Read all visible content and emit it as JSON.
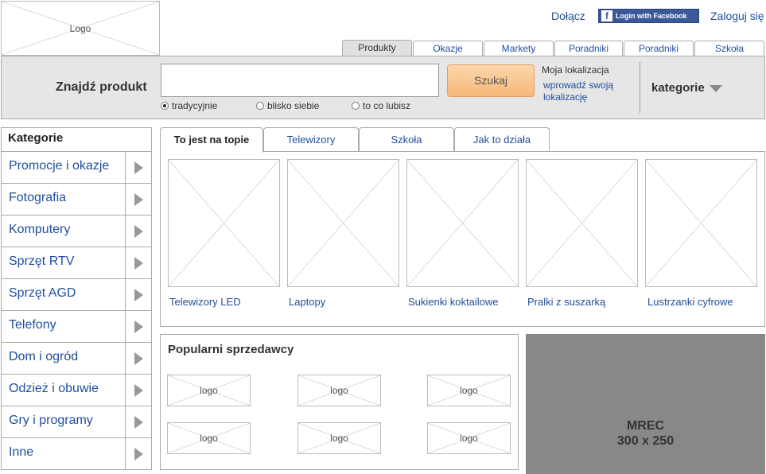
{
  "header": {
    "logo_label": "Logo",
    "join_label": "Dołącz",
    "facebook_label": "Login with Facebook",
    "login_label": "Zaloguj się",
    "top_tabs": [
      {
        "label": "Produkty",
        "active": true
      },
      {
        "label": "Okazje"
      },
      {
        "label": "Markety"
      },
      {
        "label": "Poradniki"
      },
      {
        "label": "Poradniki"
      },
      {
        "label": "Szkoła"
      }
    ]
  },
  "search": {
    "title": "Znajdź produkt",
    "input_value": "",
    "button_label": "Szukaj",
    "modes": [
      {
        "label": "tradycyjnie",
        "selected": true
      },
      {
        "label": "blisko siebie"
      },
      {
        "label": "to co lubisz"
      }
    ],
    "location_label": "Moja lokalizacja",
    "location_link": "wprowadź swoją lokalizację",
    "categories_label": "kategorie"
  },
  "sidebar": {
    "title": "Kategorie",
    "items": [
      {
        "label": "Promocje i okazje"
      },
      {
        "label": "Fotografia"
      },
      {
        "label": "Komputery"
      },
      {
        "label": "Sprzęt RTV"
      },
      {
        "label": "Sprzęt AGD"
      },
      {
        "label": "Telefony"
      },
      {
        "label": "Dom i ogród"
      },
      {
        "label": "Odzież i obuwie"
      },
      {
        "label": "Gry i programy"
      },
      {
        "label": "Inne"
      }
    ]
  },
  "main": {
    "tabs": [
      {
        "label": "To jest na topie",
        "active": true
      },
      {
        "label": "Telewizory"
      },
      {
        "label": "Szkoła"
      },
      {
        "label": "Jak to działa"
      }
    ],
    "products": [
      {
        "caption": "Telewizory LED"
      },
      {
        "caption": "Laptopy"
      },
      {
        "caption": "Sukienki koktailowe"
      },
      {
        "caption": "Pralki z suszarką"
      },
      {
        "caption": "Lustrzanki cyfrowe"
      }
    ]
  },
  "sellers": {
    "title": "Popularni sprzedawcy",
    "logos": [
      "logo",
      "logo",
      "logo",
      "logo",
      "logo",
      "logo"
    ]
  },
  "mrec": {
    "line1": "MREC",
    "line2": "300 x 250"
  },
  "colors": {
    "link": "#1f4e9c",
    "search_bar_bg": "#e6e6e6",
    "button_bg": "#f6b87a",
    "facebook_bg": "#3b5998",
    "mrec_bg": "#888888"
  }
}
